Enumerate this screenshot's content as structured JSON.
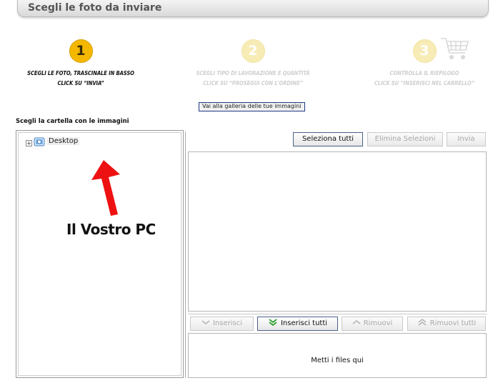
{
  "header": {
    "title": "Scegli le foto da inviare"
  },
  "steps": [
    {
      "number": "1",
      "line1": "SCEGLI LE FOTO, TRASCINALE IN BASSO",
      "line2": "CLICK SU “INVIA”",
      "state": "active"
    },
    {
      "number": "2",
      "line1": "SCEGLI TIPO DI LAVORAZIONE E QUANTITÀ",
      "line2": "CLICK SU “PROSEGUI CON L'ORDINE”",
      "state": "inactive"
    },
    {
      "number": "3",
      "line1": "CONTROLLA IL RIEPILOGO",
      "line2": "CLICK SU “INSERISCI NEL CARRELLO”",
      "state": "inactive"
    }
  ],
  "gallery_button": "Vai alla galleria delle tue immagini",
  "folder_panel": {
    "label": "Scegli la cartella con le immagini",
    "tree": [
      {
        "label": "Desktop",
        "expander": "+"
      }
    ]
  },
  "annotation": "Il Vostro PC",
  "toolbar": {
    "select_all": "Seleziona tutti",
    "delete_selection": "Elimina Selezioni",
    "send": "Invia"
  },
  "transfer": {
    "insert": "Inserisci",
    "insert_all": "Inserisci tutti",
    "remove": "Rimuovi",
    "remove_all": "Rimuovi tutti"
  },
  "drop_area": {
    "text": "Metti i files qui"
  },
  "colors": {
    "step_active": "#f5b800",
    "step_inactive": "#f7ecb5",
    "arrow": "#ee1111",
    "enabled_border": "#4a5f8a"
  }
}
